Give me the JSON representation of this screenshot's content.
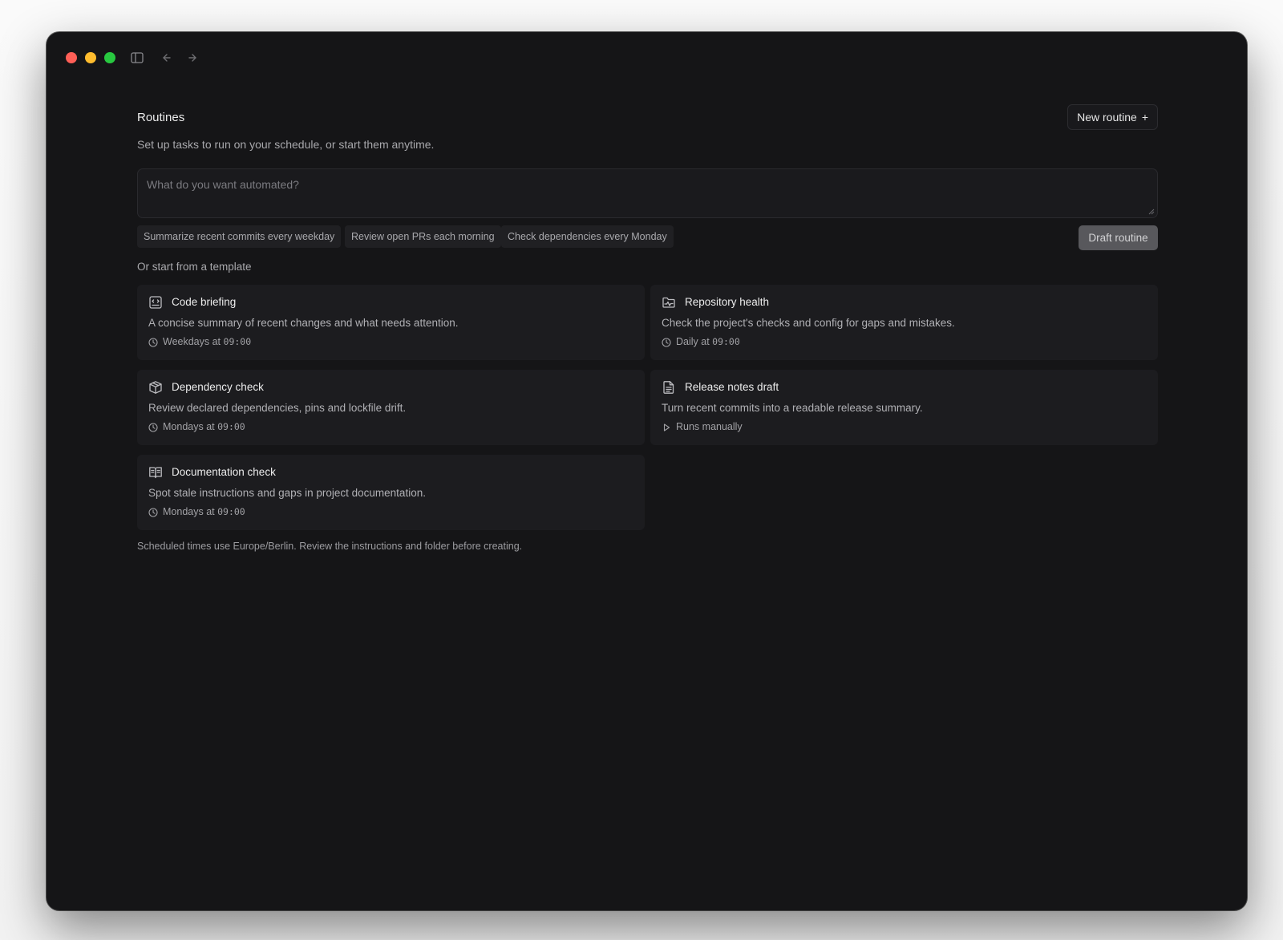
{
  "titlebar": {
    "icons": [
      "sidebar-toggle-icon",
      "back-arrow-icon",
      "forward-arrow-icon"
    ]
  },
  "header": {
    "title": "Routines",
    "new_button_label": "New routine",
    "new_button_icon": "+",
    "subtitle": "Set up tasks to run on your schedule, or start them anytime."
  },
  "prompt": {
    "placeholder": "What do you want automated?",
    "value": ""
  },
  "suggestions": [
    {
      "label": "Summarize recent commits every weekday"
    },
    {
      "label": "Review open PRs each morning"
    },
    {
      "label": "Check dependencies every Monday"
    }
  ],
  "draft_button_label": "Draft routine",
  "templates_label": "Or start from a template",
  "templates": [
    {
      "title": "Code briefing",
      "icon": "code-briefing-icon",
      "description": "A concise summary of recent changes and what needs attention.",
      "schedule_prefix": "Weekdays at ",
      "schedule_time": "09:00",
      "schedule_icon": "clock-icon"
    },
    {
      "title": "Repository health",
      "icon": "repository-health-icon",
      "description": "Check the project's checks and config for gaps and mistakes.",
      "schedule_prefix": "Daily at ",
      "schedule_time": "09:00",
      "schedule_icon": "clock-icon"
    },
    {
      "title": "Dependency check",
      "icon": "package-icon",
      "description": "Review declared dependencies, pins and lockfile drift.",
      "schedule_prefix": "Mondays at ",
      "schedule_time": "09:00",
      "schedule_icon": "clock-icon"
    },
    {
      "title": "Release notes draft",
      "icon": "document-icon",
      "description": "Turn recent commits into a readable release summary.",
      "schedule_prefix": "Runs manually",
      "schedule_time": "",
      "schedule_icon": "play-icon"
    },
    {
      "title": "Documentation check",
      "icon": "book-icon",
      "description": "Spot stale instructions and gaps in project documentation.",
      "schedule_prefix": "Mondays at ",
      "schedule_time": "09:00",
      "schedule_icon": "clock-icon"
    }
  ],
  "footnote": "Scheduled times use Europe/Berlin. Review the instructions and folder before creating.",
  "colors": {
    "window_bg": "#151517",
    "card_bg": "#1c1c1f",
    "close": "#ff5f57",
    "minimize": "#febc2e",
    "maximize": "#28c840",
    "draft_button_bg": "#58585c"
  }
}
